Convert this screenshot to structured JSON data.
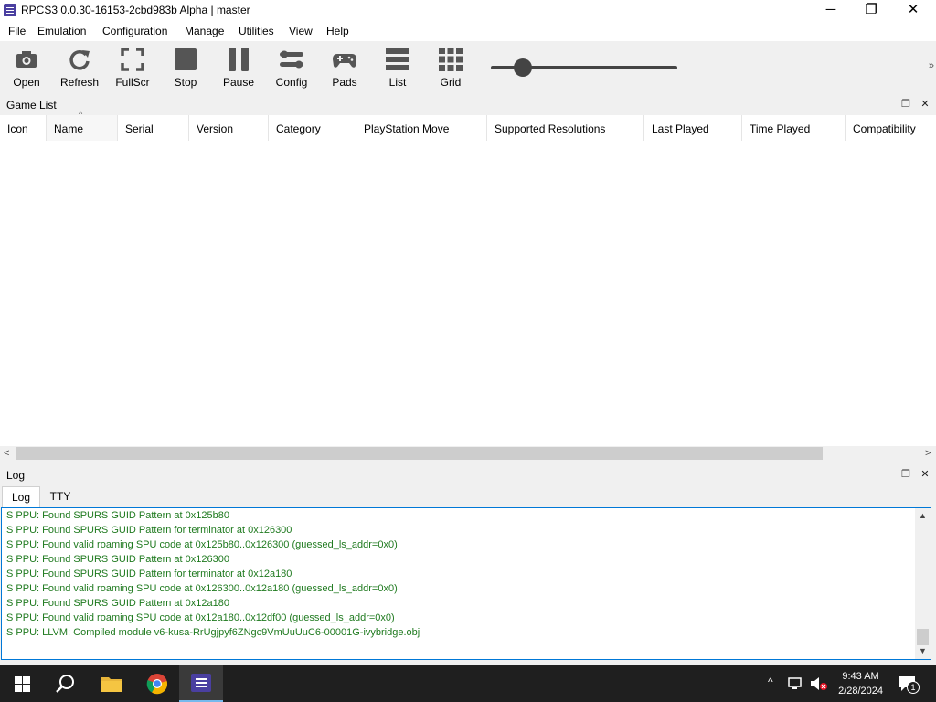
{
  "window": {
    "title": "RPCS3 0.0.30-16153-2cbd983b Alpha | master",
    "controls": {
      "minimize": "─",
      "restore": "❐",
      "close": "✕"
    }
  },
  "menu": [
    "File",
    "Emulation",
    "Configuration",
    "Manage",
    "Utilities",
    "View",
    "Help"
  ],
  "toolbar": {
    "buttons": [
      {
        "label": "Open",
        "icon": "camera-icon"
      },
      {
        "label": "Refresh",
        "icon": "refresh-icon"
      },
      {
        "label": "FullScr",
        "icon": "fullscreen-icon"
      },
      {
        "label": "Stop",
        "icon": "stop-icon"
      },
      {
        "label": "Pause",
        "icon": "pause-icon"
      },
      {
        "label": "Config",
        "icon": "config-icon"
      },
      {
        "label": "Pads",
        "icon": "gamepad-icon"
      },
      {
        "label": "List",
        "icon": "list-icon"
      },
      {
        "label": "Grid",
        "icon": "grid-icon"
      }
    ],
    "zoom_slider_value": 0.17,
    "overflow": "»"
  },
  "gamelist": {
    "title": "Game List",
    "columns": [
      "Icon",
      "Name",
      "Serial",
      "Version",
      "Category",
      "PlayStation Move",
      "Supported Resolutions",
      "Last Played",
      "Time Played",
      "Compatibility"
    ]
  },
  "log": {
    "title": "Log",
    "tabs": [
      "Log",
      "TTY"
    ],
    "lines": [
      "S PPU: Found SPURS GUID Pattern at 0x125b80",
      "S PPU: Found SPURS GUID Pattern for terminator at 0x126300",
      "S PPU: Found valid roaming SPU code at 0x125b80..0x126300 (guessed_ls_addr=0x0)",
      "S PPU: Found SPURS GUID Pattern at 0x126300",
      "S PPU: Found SPURS GUID Pattern for terminator at 0x12a180",
      "S PPU: Found valid roaming SPU code at 0x126300..0x12a180 (guessed_ls_addr=0x0)",
      "S PPU: Found SPURS GUID Pattern at 0x12a180",
      "S PPU: Found valid roaming SPU code at 0x12a180..0x12df00 (guessed_ls_addr=0x0)",
      "S PPU: LLVM: Compiled module v6-kusa-RrUgjpyf6ZNgc9VmUuUuC6-00001G-ivybridge.obj"
    ],
    "line_color": "#1f7a1f"
  },
  "taskbar": {
    "time": "9:43 AM",
    "date": "2/28/2024",
    "notification_count": "1"
  },
  "colors": {
    "accent": "#0078d7",
    "taskbar": "#1f1f1f",
    "app_icon": "#4a3fa0"
  }
}
